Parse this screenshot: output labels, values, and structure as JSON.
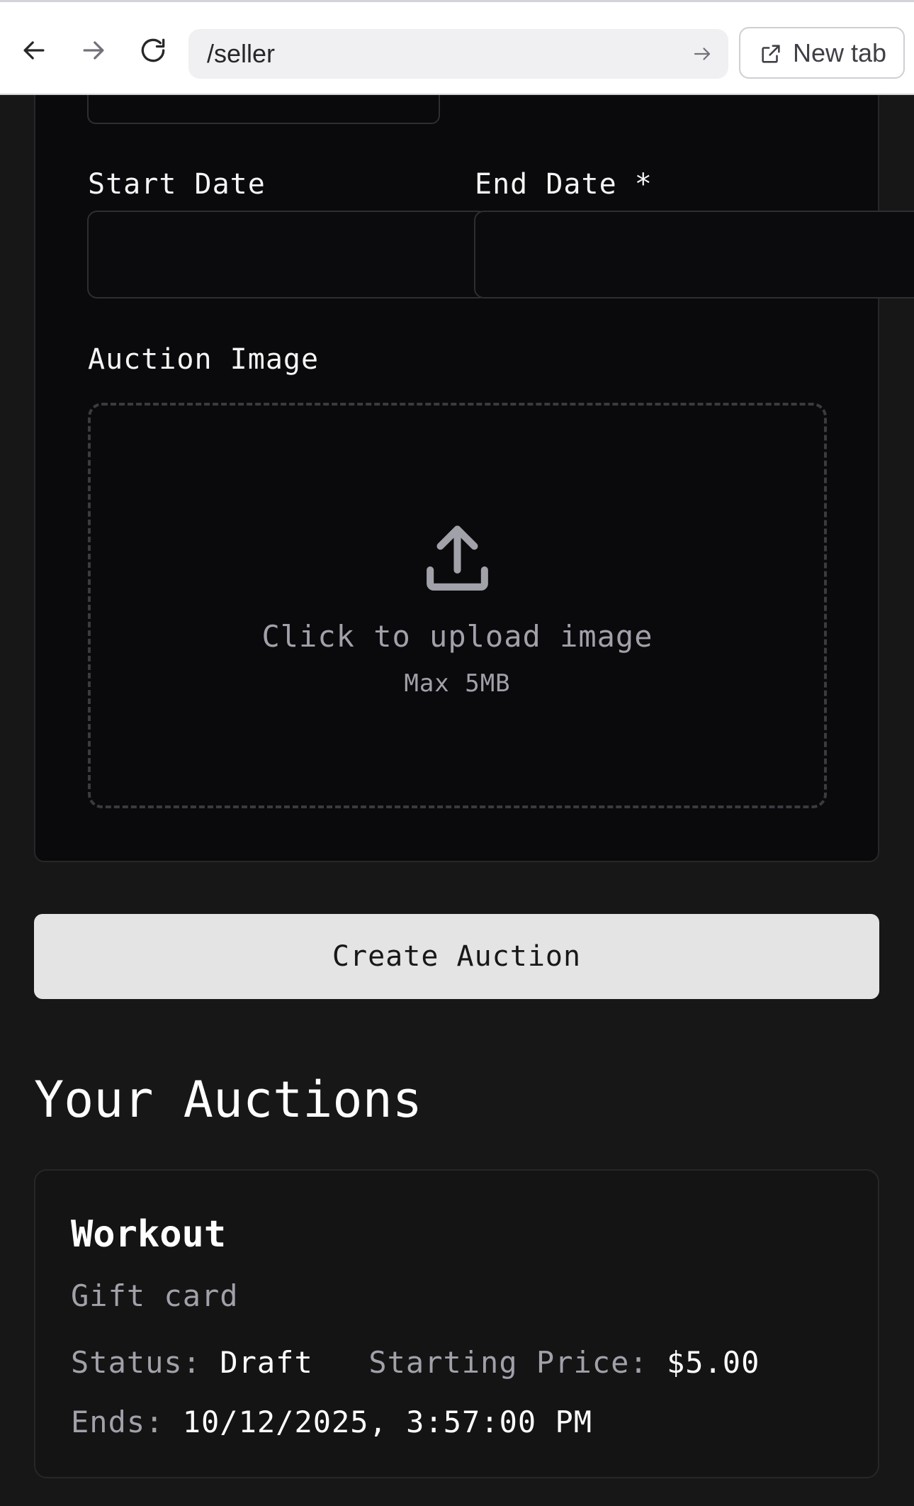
{
  "browser": {
    "url": "/seller",
    "new_tab_label": "New tab",
    "icons": [
      "back-arrow-icon",
      "forward-arrow-icon",
      "reload-icon",
      "go-arrow-icon",
      "external-link-icon"
    ]
  },
  "form": {
    "start_date_label": "Start Date",
    "end_date_label": "End Date *",
    "image_label": "Auction Image",
    "upload_text": "Click to upload image",
    "upload_subtext": "Max 5MB",
    "upload_icon": "upload-icon",
    "submit_label": "Create Auction"
  },
  "auctions": {
    "section_title": "Your Auctions",
    "items": [
      {
        "title": "Workout",
        "description": "Gift card",
        "status_label": "Status:",
        "status_value": "Draft",
        "price_label": "Starting Price:",
        "price_value": "$5.00",
        "ends_label": "Ends:",
        "ends_value": "10/12/2025, 3:57:00 PM"
      }
    ]
  },
  "colors": {
    "page_background": "#171717",
    "card_background": "#0a0a0c",
    "button_background": "#e4e4e4",
    "muted_text": "#a1a1aa"
  }
}
